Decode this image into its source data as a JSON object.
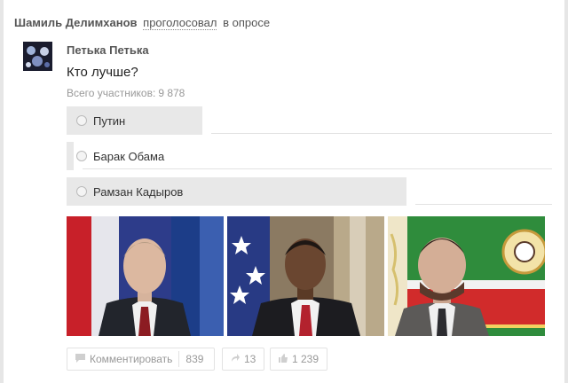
{
  "header": {
    "author": "Шамиль Делимханов",
    "action": "проголосовал",
    "rest": "в опросе"
  },
  "post": {
    "poster": "Петька Петька",
    "question": "Кто лучше?",
    "participants_label": "Всего участников:",
    "participants_count": "9 878"
  },
  "poll": {
    "options": [
      {
        "label": "Путин",
        "share": 0.28
      },
      {
        "label": "Барак Обама",
        "share": 0.015
      },
      {
        "label": "Рамзан Кадыров",
        "share": 0.7
      }
    ]
  },
  "photos": [
    {
      "icon": "putin-photo"
    },
    {
      "icon": "obama-photo"
    },
    {
      "icon": "kadyrov-photo"
    }
  ],
  "actions": {
    "comment_label": "Комментировать",
    "comment_count": "839",
    "share_count": "13",
    "like_count": "1 239"
  },
  "colors": {
    "poll_bar": "#e8e8e8",
    "text_gray": "#999999"
  }
}
